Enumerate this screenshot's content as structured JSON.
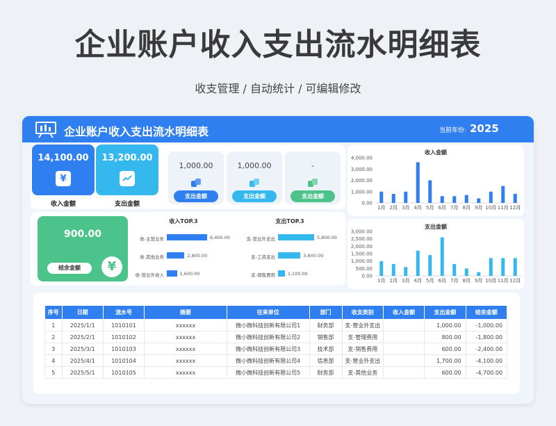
{
  "page": {
    "title": "企业账户收入支出流水明细表",
    "subtitle": "收支管理 / 自动统计 / 可编辑修改"
  },
  "header": {
    "title": "企业账户收入支出流水明细表",
    "year_label": "当前年份:",
    "year_value": "2025"
  },
  "kpis": {
    "income": {
      "value": "14,100.00",
      "label": "收入金额",
      "icon": "yen-icon"
    },
    "expense": {
      "value": "13,200.00",
      "label": "支出金额",
      "icon": "trend-icon"
    },
    "balance": {
      "value": "900.00",
      "label": "结余金额",
      "icon": "yen-circle-icon"
    }
  },
  "small_cards": [
    {
      "value": "1,000.00",
      "label": "支出金额",
      "color": "#2f7ff0"
    },
    {
      "value": "1,000.00",
      "label": "支出金额",
      "color": "#35b8ee"
    },
    {
      "value": "-",
      "label": "支出金额",
      "color": "#4cc38a"
    }
  ],
  "income_top3": {
    "title": "收入TOP.3",
    "items": [
      {
        "label": "收-主营业务",
        "value": 6400,
        "value_label": "6,400.00"
      },
      {
        "label": "收-其他业务",
        "value": 2800,
        "value_label": "2,800.00"
      },
      {
        "label": "收-营业外收入",
        "value": 1600,
        "value_label": "1,600.00"
      }
    ]
  },
  "expense_top3": {
    "title": "支出TOP.3",
    "items": [
      {
        "label": "支-营业外支出",
        "value": 5800,
        "value_label": "5,800.00"
      },
      {
        "label": "支-工资支出",
        "value": 3600,
        "value_label": "3,600.00"
      },
      {
        "label": "支-销售费用",
        "value": 1100,
        "value_label": "1,100.00"
      }
    ]
  },
  "chart_data": [
    {
      "type": "bar",
      "title": "收入金额",
      "categories": [
        "1月",
        "2月",
        "3月",
        "4月",
        "5月",
        "6月",
        "7月",
        "8月",
        "9月",
        "10月",
        "11月",
        "12月"
      ],
      "values": [
        1000,
        800,
        1000,
        3600,
        2000,
        600,
        600,
        700,
        400,
        1000,
        1500,
        800
      ],
      "ylim": [
        0,
        4000
      ],
      "yticks": [
        "0.00",
        "1,000.00",
        "2,000.00",
        "3,000.00",
        "4,000.00"
      ],
      "color": "#2f7ff0"
    },
    {
      "type": "bar",
      "title": "支出金额",
      "categories": [
        "1月",
        "2月",
        "3月",
        "4月",
        "5月",
        "6月",
        "7月",
        "8月",
        "9月",
        "10月",
        "11月",
        "12月"
      ],
      "values": [
        1000,
        800,
        600,
        1700,
        1400,
        2600,
        800,
        500,
        250,
        1200,
        1200,
        1200
      ],
      "ylim": [
        0,
        3000
      ],
      "yticks": [
        "0.00",
        "500.00",
        "1,000.00",
        "1,500.00",
        "2,000.00",
        "2,500.00",
        "3,000.00"
      ],
      "color": "#35b8ee"
    }
  ],
  "table": {
    "headers": [
      "序号",
      "日期",
      "流水号",
      "摘要",
      "往来单位",
      "部门",
      "收支类别",
      "收入金额",
      "支出金额",
      "结余金额"
    ],
    "rows": [
      [
        "1",
        "2025/1/1",
        "1010101",
        "xxxxxx",
        "微小微科技创新有限公司1",
        "财务部",
        "支-营业外支出",
        "",
        "1,000.00",
        "-1,000.00"
      ],
      [
        "2",
        "2025/2/1",
        "1010102",
        "xxxxxx",
        "微小微科技创新有限公司2",
        "销售部",
        "支-管理费用",
        "",
        "800.00",
        "-1,800.00"
      ],
      [
        "3",
        "2025/3/1",
        "1010103",
        "xxxxxx",
        "微小微科技创新有限公司3",
        "技术部",
        "支-销售费用",
        "",
        "600.00",
        "-2,400.00"
      ],
      [
        "4",
        "2025/4/1",
        "1010104",
        "xxxxxx",
        "微小微科技创新有限公司4",
        "信息部",
        "支-营业外支出",
        "",
        "1,700.00",
        "-4,100.00"
      ],
      [
        "5",
        "2025/5/1",
        "1010105",
        "xxxxxx",
        "微小微科技创新有限公司5",
        "财务部",
        "支-其他业务",
        "",
        "600.00",
        "-4,700.00"
      ]
    ]
  }
}
